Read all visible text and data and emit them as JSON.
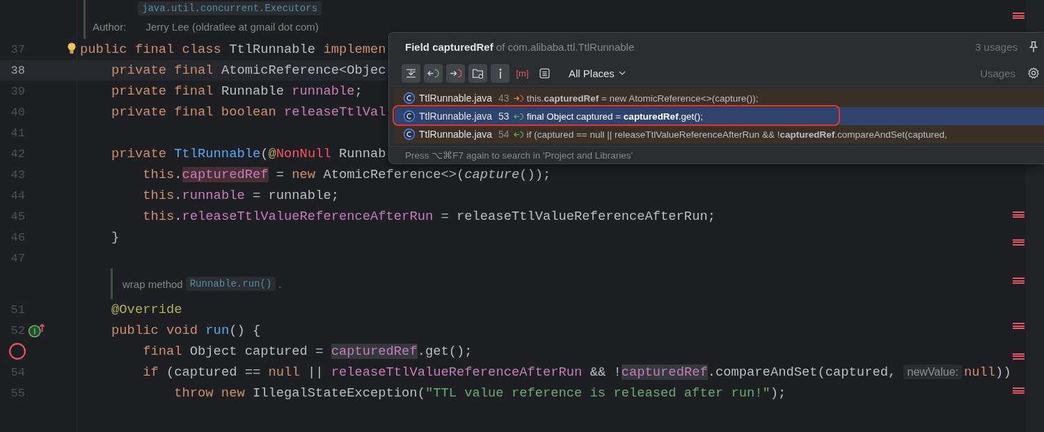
{
  "doc_top": {
    "chip": "java.util.concurrent.Executors",
    "label": "Author:",
    "text": "Jerry Lee (oldratlee at gmail dot com)"
  },
  "lines": [
    {
      "kind": "code",
      "number": "37",
      "current": false,
      "bulb": true,
      "tokens": [
        {
          "kind": "kw",
          "t": "public final class"
        },
        {
          "kind": "plain",
          "t": " TtlRunnable "
        },
        {
          "kind": "kw",
          "t": "implemen"
        }
      ]
    },
    {
      "kind": "code",
      "number": "38",
      "current": true,
      "tokens": [
        {
          "kind": "kw",
          "t": "    private final"
        },
        {
          "kind": "plain",
          "t": " AtomicReference<Objec"
        }
      ]
    },
    {
      "kind": "code",
      "number": "39",
      "current": false,
      "tokens": [
        {
          "kind": "kw",
          "t": "    private final"
        },
        {
          "kind": "plain",
          "t": " Runnable "
        },
        {
          "kind": "field",
          "t": "runnable"
        },
        {
          "kind": "plain",
          "t": ";"
        }
      ]
    },
    {
      "kind": "code",
      "number": "40",
      "current": false,
      "tokens": [
        {
          "kind": "kw",
          "t": "    private final boolean "
        },
        {
          "kind": "field",
          "t": "releaseTtlVal"
        }
      ]
    },
    {
      "kind": "code",
      "number": "41",
      "current": false
    },
    {
      "kind": "code",
      "number": "42",
      "current": false,
      "tokens": [
        {
          "kind": "kw",
          "t": "    private "
        },
        {
          "kind": "fn",
          "t": "TtlRunnable"
        },
        {
          "kind": "plain",
          "t": "("
        },
        {
          "kind": "ann",
          "t": "@"
        },
        {
          "kind": "unres",
          "t": "NonNull"
        },
        {
          "kind": "plain",
          "t": " Runnab"
        }
      ]
    },
    {
      "kind": "code",
      "number": "43",
      "current": false,
      "tokens": [
        {
          "kind": "kw",
          "t": "        this"
        },
        {
          "kind": "plain",
          "t": "."
        },
        {
          "kind": "field",
          "t": "capturedRef",
          "write_usage": true
        },
        {
          "kind": "plain",
          "t": " = "
        },
        {
          "kind": "kw",
          "t": "new"
        },
        {
          "kind": "plain",
          "t": " AtomicReference<>("
        },
        {
          "kind": "static",
          "t": "capture"
        },
        {
          "kind": "plain",
          "t": "());"
        }
      ]
    },
    {
      "kind": "code",
      "number": "44",
      "current": false,
      "tokens": [
        {
          "kind": "kw",
          "t": "        this"
        },
        {
          "kind": "plain",
          "t": "."
        },
        {
          "kind": "field",
          "t": "runnable"
        },
        {
          "kind": "plain",
          "t": " = runnable;"
        }
      ]
    },
    {
      "kind": "code",
      "number": "45",
      "current": false,
      "tokens": [
        {
          "kind": "kw",
          "t": "        this"
        },
        {
          "kind": "plain",
          "t": "."
        },
        {
          "kind": "field",
          "t": "releaseTtlValueReferenceAfterRun"
        },
        {
          "kind": "plain",
          "t": " = releaseTtlValueReferenceAfterRun;"
        }
      ]
    },
    {
      "kind": "code",
      "number": "46",
      "current": false,
      "tokens": [
        {
          "kind": "plain",
          "t": "    }"
        }
      ]
    },
    {
      "kind": "code",
      "number": "47",
      "current": false
    },
    {
      "kind": "doc",
      "text": "wrap method",
      "chip": "Runnable.run()",
      "tail": "."
    },
    {
      "kind": "code",
      "number": "51",
      "current": false,
      "tokens": [
        {
          "kind": "ann",
          "t": "    @Override"
        }
      ]
    },
    {
      "kind": "code",
      "number": "52",
      "current": false,
      "implements": true,
      "tokens": [
        {
          "kind": "kw",
          "t": "    public void "
        },
        {
          "kind": "fn",
          "t": "run"
        },
        {
          "kind": "plain",
          "t": "() {"
        }
      ]
    },
    {
      "kind": "code",
      "current": false,
      "breakpoint": true,
      "tokens": [
        {
          "kind": "kw",
          "t": "        final"
        },
        {
          "kind": "plain",
          "t": " Object captured = "
        },
        {
          "kind": "field",
          "t": "capturedRef",
          "read_usage": true
        },
        {
          "kind": "plain",
          "t": ".get();"
        }
      ]
    },
    {
      "kind": "code",
      "number": "54",
      "current": false,
      "tokens": [
        {
          "kind": "kw",
          "t": "        if"
        },
        {
          "kind": "plain",
          "t": " (captured == "
        },
        {
          "kind": "kw",
          "t": "null"
        },
        {
          "kind": "plain",
          "t": " || "
        },
        {
          "kind": "field",
          "t": "releaseTtlValueReferenceAfterRun"
        },
        {
          "kind": "plain",
          "t": " && !"
        },
        {
          "kind": "field",
          "t": "capturedRef",
          "read_usage": true
        },
        {
          "kind": "plain",
          "t": ".compareAndSet(captured, "
        },
        {
          "kind": "hint",
          "t": "newValue:"
        },
        {
          "kind": "kw",
          "t": "null"
        },
        {
          "kind": "plain",
          "t": "))"
        }
      ]
    },
    {
      "kind": "code",
      "number": "55",
      "current": false,
      "tokens": [
        {
          "kind": "kw",
          "t": "            throw new"
        },
        {
          "kind": "plain",
          "t": " IllegalStateException("
        },
        {
          "kind": "str",
          "t": "\"TTL value reference is released after run!\""
        },
        {
          "kind": "plain",
          "t": ");"
        }
      ]
    }
  ],
  "popup": {
    "title": "**Field capturedRef** of com.alibaba.ttl.TtlRunnable",
    "count": "3 usages",
    "tools": [
      {
        "kind": "merge",
        "selected": true
      },
      {
        "kind": "read",
        "selected": true
      },
      {
        "kind": "write",
        "selected": true
      },
      {
        "kind": "folder",
        "selected": true
      },
      {
        "kind": "info",
        "selected": true
      },
      {
        "kind": "method",
        "glyph": "[m]",
        "selected": false
      },
      {
        "kind": "preview",
        "selected": false
      }
    ],
    "scope": "All Places",
    "group": "Usages",
    "results": [
      {
        "file": "TtlRunnable.java",
        "line": "43",
        "write": true,
        "selected": false,
        "code": "this.**capturedRef** = new AtomicReference<>(capture());"
      },
      {
        "file": "TtlRunnable.java",
        "line": "53",
        "write": false,
        "selected": true,
        "code": "final Object captured = **capturedRef**.get();"
      },
      {
        "file": "TtlRunnable.java",
        "line": "54",
        "write": false,
        "selected": false,
        "code": "if (captured == null || releaseTtlValueReferenceAfterRun && !**capturedRef**.compareAndSet(captured,"
      }
    ],
    "hint": "Press ⌥⌘F7 again to search in 'Project and Libraries'"
  }
}
